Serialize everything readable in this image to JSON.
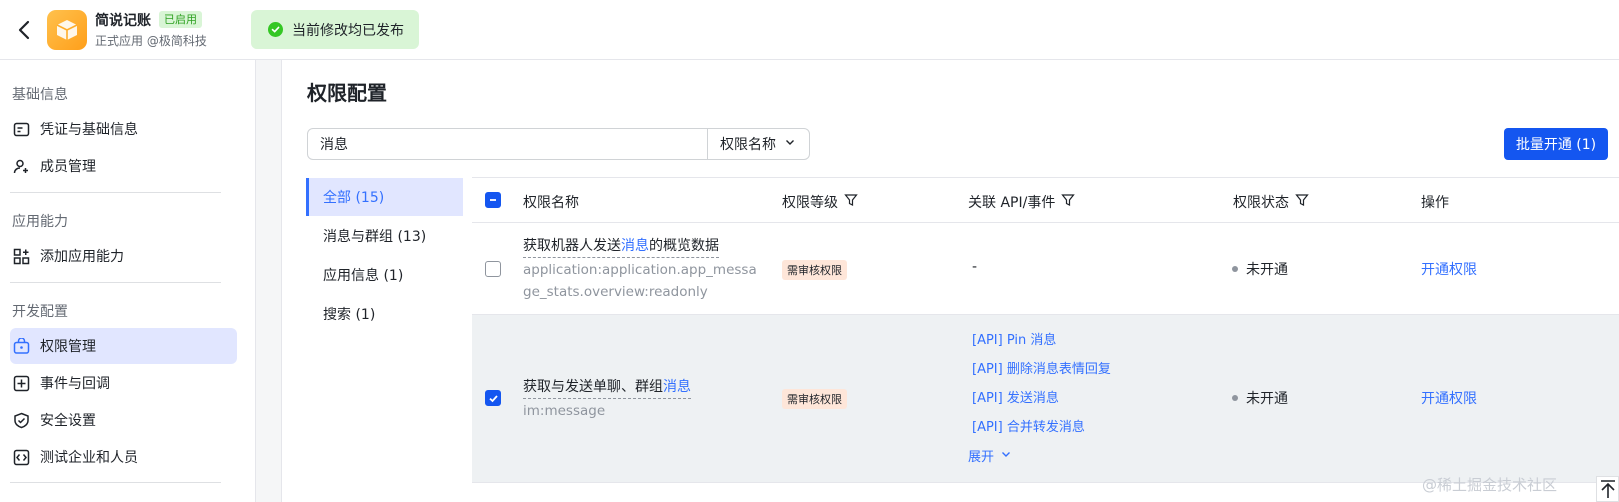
{
  "header": {
    "app_name": "简说记账",
    "app_badge": "已启用",
    "app_sub": "正式应用 @极简科技",
    "toast": "当前修改均已发布"
  },
  "sidebar": {
    "sections": [
      {
        "title": "基础信息",
        "items": [
          {
            "label": "凭证与基础信息",
            "icon": "id-card-icon"
          },
          {
            "label": "成员管理",
            "icon": "user-add-icon"
          }
        ]
      },
      {
        "title": "应用能力",
        "items": [
          {
            "label": "添加应用能力",
            "icon": "grid-add-icon"
          }
        ]
      },
      {
        "title": "开发配置",
        "items": [
          {
            "label": "权限管理",
            "icon": "permission-icon"
          },
          {
            "label": "事件与回调",
            "icon": "event-icon"
          },
          {
            "label": "安全设置",
            "icon": "shield-icon"
          },
          {
            "label": "测试企业和人员",
            "icon": "test-icon"
          }
        ]
      }
    ]
  },
  "main": {
    "title": "权限配置",
    "search": {
      "value": "消息",
      "type": "权限名称"
    },
    "batch_button": "批量开通 (1)",
    "filters": [
      "全部 (15)",
      "消息与群组 (13)",
      "应用信息 (1)",
      "搜索 (1)"
    ],
    "columns": {
      "name": "权限名称",
      "level": "权限等级",
      "api": "关联 API/事件",
      "status": "权限状态",
      "op": "操作"
    },
    "rows": [
      {
        "name_pre": "获取机器人发送",
        "name_hl": "消息",
        "name_post": "的概览数据",
        "key": "application:application.app_message_stats.overview:readonly",
        "level": "需审核权限",
        "api_empty": "-",
        "status": "未开通",
        "op": "开通权限",
        "checked": false
      },
      {
        "name_pre": "获取与发送单聊、群组",
        "name_hl": "消息",
        "name_post": "",
        "key": "im:message",
        "level": "需审核权限",
        "apis": [
          "[API] Pin 消息",
          "[API] 删除消息表情回复",
          "[API] 发送消息",
          "[API] 合并转发消息"
        ],
        "expand": "展开",
        "status": "未开通",
        "op": "开通权限",
        "checked": true
      }
    ]
  },
  "watermark": "@稀土掘金技术社区"
}
